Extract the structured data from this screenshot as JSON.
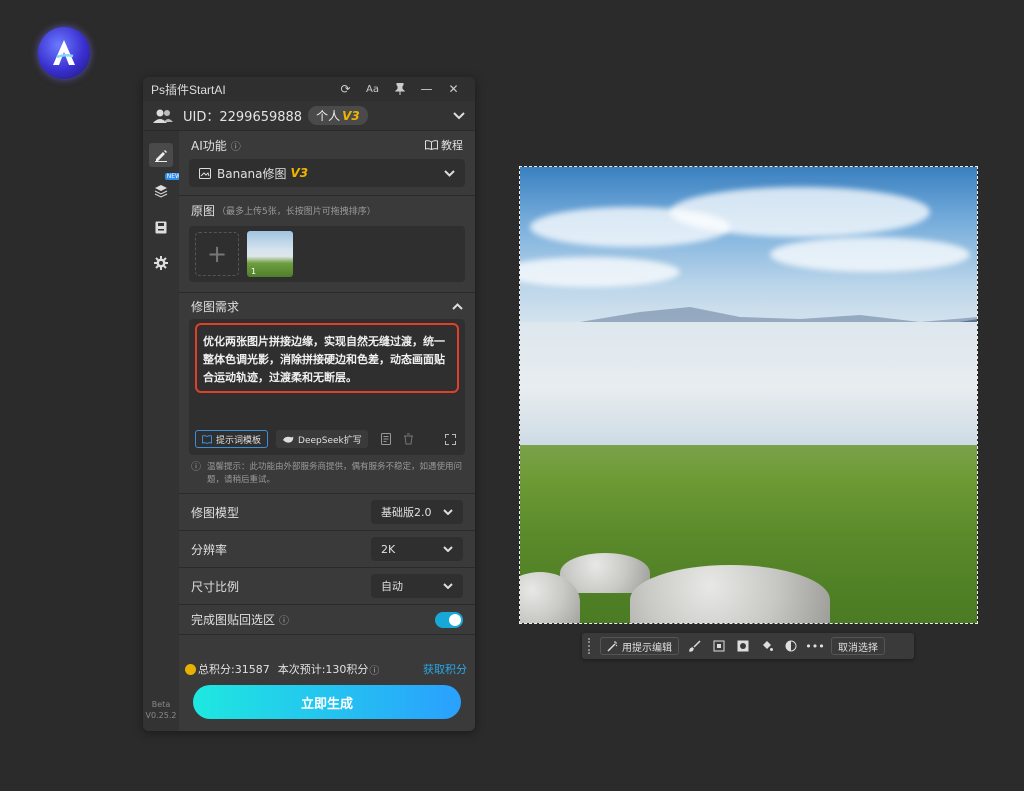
{
  "window": {
    "title": "Ps插件StartAI"
  },
  "user": {
    "uid_label": "UID：2299659888",
    "plan": "个人",
    "plan_version": "V3"
  },
  "sidebar": {
    "new_tag": "NEW",
    "beta": "Beta",
    "version": "V0.25.2"
  },
  "ai_function": {
    "label": "AI功能",
    "tutorial": "教程",
    "selected": "Banana修图",
    "selected_version": "V3"
  },
  "source_image": {
    "label": "原图",
    "hint": "（最多上传5张，长按图片可拖拽排序）",
    "thumb_index": "1"
  },
  "edit_request": {
    "label": "修图需求",
    "prompt": "优化两张图片拼接边缘，实现自然无缝过渡，统一整体色调光影，消除拼接硬边和色差，动态画面贴合运动轨迹，过渡柔和无断层。",
    "template_button": "提示词模板",
    "deepseek_button": "DeepSeek扩写"
  },
  "tip": {
    "text": "温馨提示：此功能由外部服务商提供，偶有服务不稳定，如遇使用问题，请稍后重试。"
  },
  "options": {
    "model": {
      "label": "修图模型",
      "value": "基础版2.0"
    },
    "resolution": {
      "label": "分辨率",
      "value": "2K"
    },
    "ratio": {
      "label": "尺寸比例",
      "value": "自动"
    },
    "paste_back": {
      "label": "完成图贴回选区",
      "enabled": true
    }
  },
  "points": {
    "total": "总积分:31587",
    "estimate": "本次预计:130积分",
    "get": "获取积分"
  },
  "generate": {
    "label": "立即生成"
  },
  "float_toolbar": {
    "edit_with_prompt": "用提示编辑",
    "deselect": "取消选择"
  },
  "colors": {
    "accent": "#28a8e8",
    "highlight_border": "#e0402a",
    "generate_start": "#1ee8e0",
    "generate_end": "#2aa0ff",
    "coin": "#e8b000"
  }
}
